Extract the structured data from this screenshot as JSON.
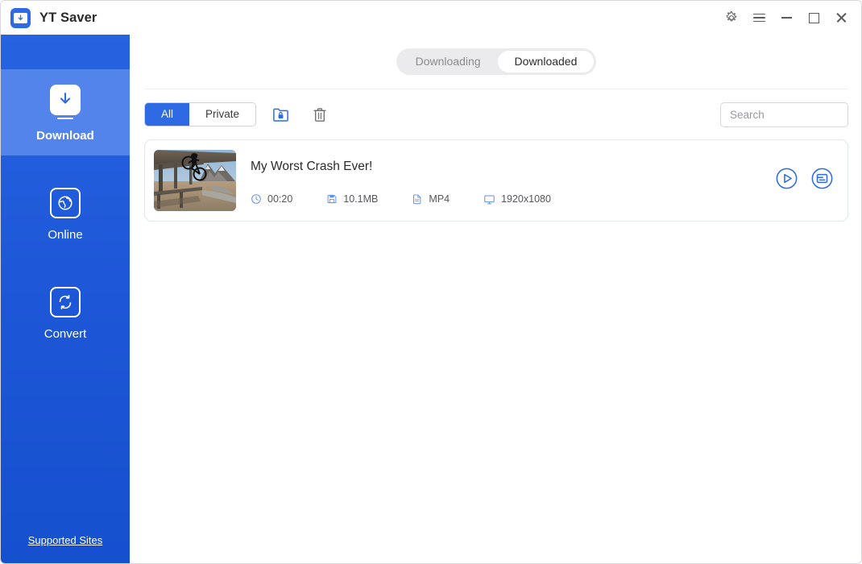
{
  "window": {
    "app_title": "YT Saver",
    "logo_icon": "download-app-logo-icon",
    "controls": {
      "settings_label": "Settings",
      "settings_icon": "gear-icon",
      "menu_label": "Menu",
      "menu_icon": "hamburger-menu-icon",
      "minimize_label": "Minimize",
      "minimize_icon": "minimize-icon",
      "maximize_label": "Maximize",
      "maximize_icon": "maximize-icon",
      "close_label": "Close",
      "close_icon": "close-icon"
    }
  },
  "sidebar": {
    "items": [
      {
        "label": "Download",
        "icon": "download-arrow-icon",
        "active": true
      },
      {
        "label": "Online",
        "icon": "globe-icon",
        "active": false
      },
      {
        "label": "Convert",
        "icon": "convert-refresh-icon",
        "active": false
      }
    ],
    "footer_link": "Supported Sites"
  },
  "main": {
    "tabs": [
      {
        "label": "Downloading",
        "active": false
      },
      {
        "label": "Downloaded",
        "active": true
      }
    ],
    "filters": [
      {
        "label": "All",
        "active": true
      },
      {
        "label": "Private",
        "active": false
      }
    ],
    "tools": [
      {
        "name": "private-folder-button",
        "icon": "folder-lock-icon"
      },
      {
        "name": "delete-button",
        "icon": "trash-icon"
      }
    ],
    "search": {
      "placeholder": "Search",
      "value": ""
    },
    "downloads": [
      {
        "title": "My Worst Crash Ever!",
        "duration": "00:20",
        "duration_icon": "clock-icon",
        "size": "10.1MB",
        "size_icon": "save-disk-icon",
        "format": "MP4",
        "format_icon": "file-document-icon",
        "resolution": "1920x1080",
        "resolution_icon": "monitor-icon",
        "actions": [
          {
            "name": "play-button",
            "icon": "play-circle-icon"
          },
          {
            "name": "open-folder-button",
            "icon": "folder-circle-icon"
          }
        ]
      }
    ]
  },
  "colors": {
    "accent": "#2d6ae3",
    "sidebar_top": "#2563e0",
    "sidebar_bottom": "#1550cf",
    "sidebar_active": "#5284ec",
    "card_border": "#dfe7f8",
    "text_primary": "#2b2b2b",
    "text_muted": "#8b8b90"
  }
}
